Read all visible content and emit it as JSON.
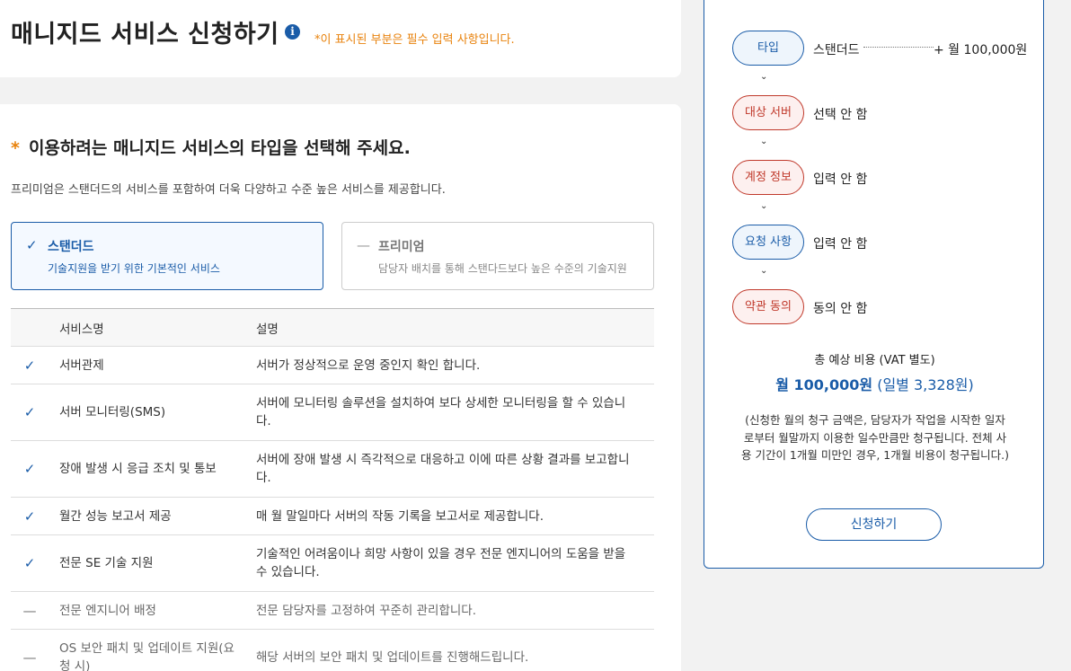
{
  "header": {
    "title": "매니지드 서비스 신청하기",
    "info_icon": "info-icon",
    "required_note": "*이 표시된 부분은 필수 입력 사항입니다."
  },
  "main": {
    "section_star": "*",
    "section_title": "이용하려는 매니지드 서비스의 타입을 선택해 주세요.",
    "section_desc": "프리미엄은 스탠더드의 서비스를 포함하여 더욱 다양하고 수준 높은 서비스를 제공합니다.",
    "types": [
      {
        "icon": "✓",
        "name": "스탠더드",
        "desc": "기술지원을 받기 위한 기본적인 서비스",
        "selected": true
      },
      {
        "icon": "—",
        "name": "프리미엄",
        "desc": "담당자 배치를 통해 스탠다드보다 높은 수준의 기술지원",
        "selected": false
      }
    ],
    "table": {
      "headers": [
        "서비스명",
        "설명"
      ],
      "rows": [
        {
          "icon": "✓",
          "included": true,
          "name": "서버관제",
          "desc": "서버가 정상적으로 운영 중인지 확인 합니다."
        },
        {
          "icon": "✓",
          "included": true,
          "name": "서버 모니터링(SMS)",
          "desc": "서버에 모니터링 솔루션을 설치하여 보다 상세한 모니터링을 할 수 있습니다."
        },
        {
          "icon": "✓",
          "included": true,
          "name": "장애 발생 시 응급 조치 및 통보",
          "desc": "서버에 장애 발생 시 즉각적으로 대응하고 이에 따른 상황 결과를 보고합니다."
        },
        {
          "icon": "✓",
          "included": true,
          "name": "월간 성능 보고서 제공",
          "desc": "매 월 말일마다 서버의 작동 기록을 보고서로 제공합니다."
        },
        {
          "icon": "✓",
          "included": true,
          "name": "전문 SE 기술 지원",
          "desc": "기술적인 어려움이나 희망 사항이 있을 경우 전문 엔지니어의 도움을 받을 수 있습니다."
        },
        {
          "icon": "—",
          "included": false,
          "name": "전문 엔지니어 배정",
          "desc": "전문 담당자를 고정하여 꾸준히 관리합니다."
        },
        {
          "icon": "—",
          "included": false,
          "name": "OS 보안 패치 및 업데이트 지원(요청 시)",
          "desc": "해당 서버의 보안 패치 및 업데이트를 진행해드립니다."
        }
      ]
    }
  },
  "summary": {
    "steps": [
      {
        "label": "타입",
        "value": "스탠더드",
        "status": "done"
      },
      {
        "label": "대상 서버",
        "value": "선택 안 함",
        "status": "todo"
      },
      {
        "label": "계정 정보",
        "value": "입력 안 함",
        "status": "todo"
      },
      {
        "label": "요청 사항",
        "value": "입력 안 함",
        "status": "done"
      },
      {
        "label": "약관 동의",
        "value": "동의 안 함",
        "status": "todo"
      }
    ],
    "arrow_icon": "⌄",
    "type_price": "+ 월 100,000원",
    "total_label": "총 예상 비용 (VAT 별도)",
    "total_monthly": "월 100,000원",
    "total_daily": "(일별 3,328원)",
    "note": "(신청한 월의 청구 금액은, 담당자가 작업을 시작한 일자로부터 월말까지 이용한 일수만큼만 청구됩니다. 전체 사용 기간이 1개월 미만인 경우, 1개월 비용이 청구됩니다.)",
    "apply_label": "신청하기"
  },
  "colors": {
    "accent": "#1a5ca8",
    "required": "#e8820c",
    "incomplete": "#c0392b"
  }
}
